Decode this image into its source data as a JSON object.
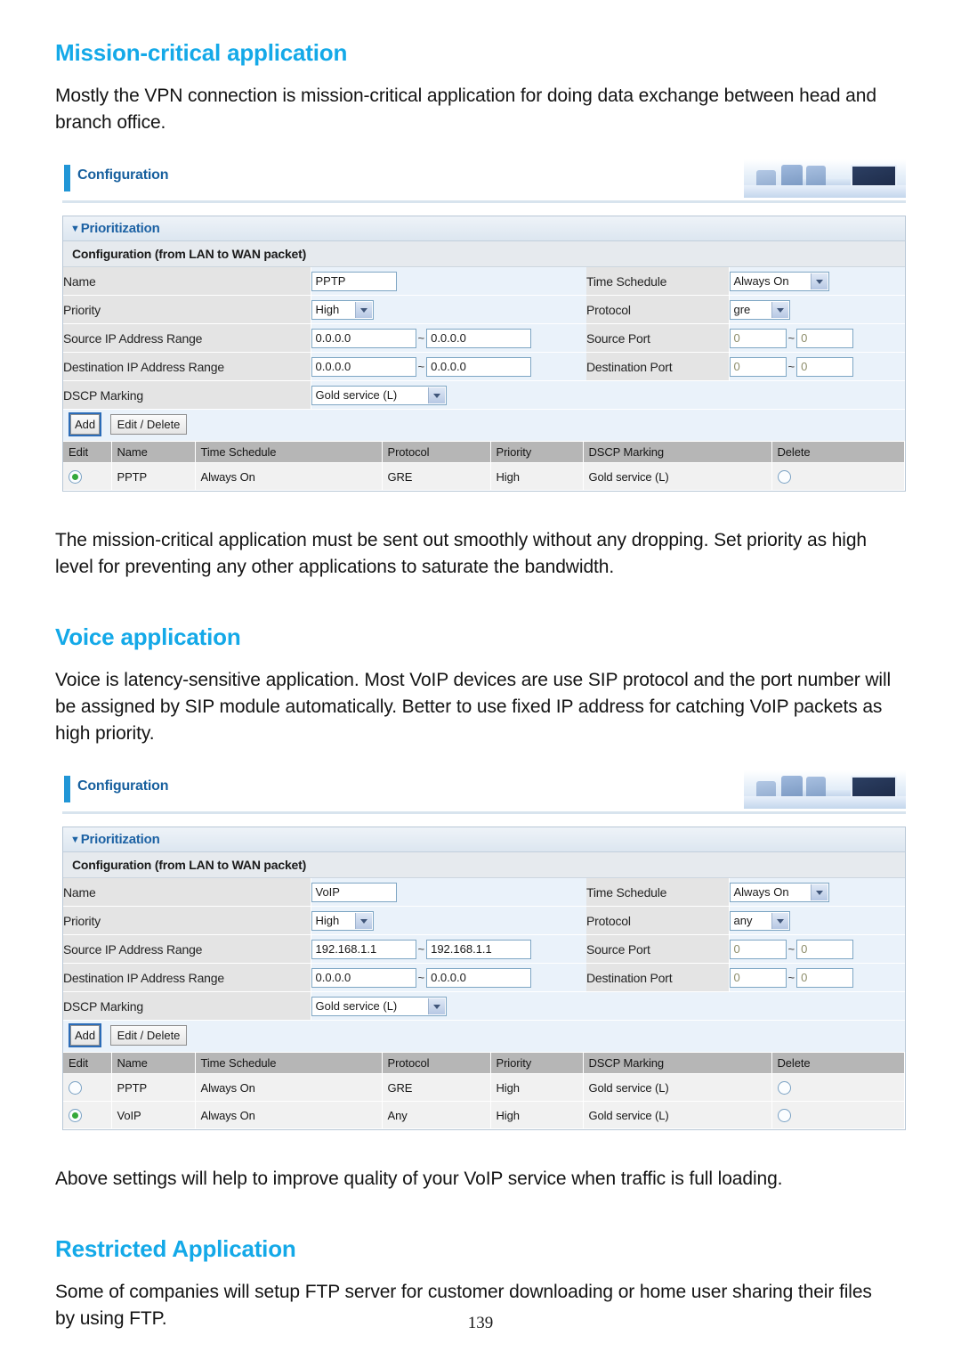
{
  "document": {
    "page_number": "139",
    "heading_color": "#14a9e8",
    "sections": [
      {
        "heading": "Mission-critical application",
        "intro": "Mostly the VPN connection is mission-critical application for doing data exchange between head and branch office.",
        "outro": "The mission-critical application must be sent out smoothly without any dropping. Set priority as high level for preventing any other applications to saturate the bandwidth."
      },
      {
        "heading": "Voice application",
        "intro": "Voice is latency-sensitive application. Most VoIP devices are use SIP protocol and the port number will be assigned by SIP module automatically. Better to use fixed IP address for catching VoIP packets as high priority.",
        "outro": "Above settings will help to improve quality of your VoIP service when traffic is full loading."
      },
      {
        "heading": "Restricted Application",
        "intro": "Some of companies will setup FTP server for customer downloading or home user sharing their files by using FTP.",
        "outro": ""
      }
    ]
  },
  "screenshot_common": {
    "config_title": "Configuration",
    "panel_title": "Prioritization",
    "panel_subtitle": "Configuration (from LAN to WAN packet)",
    "labels": {
      "name": "Name",
      "priority": "Priority",
      "source_ip": "Source IP Address Range",
      "destination_ip": "Destination IP Address Range",
      "dscp": "DSCP Marking",
      "time_schedule": "Time Schedule",
      "protocol": "Protocol",
      "source_port": "Source Port",
      "destination_port": "Destination Port"
    },
    "buttons": {
      "add": "Add",
      "edit_delete": "Edit / Delete"
    },
    "table_headers": [
      "Edit",
      "Name",
      "Time Schedule",
      "Protocol",
      "Priority",
      "DSCP Marking",
      "Delete"
    ],
    "tilde": "~"
  },
  "screenshot_one": {
    "form": {
      "name": "PPTP",
      "priority": "High",
      "source_ip_from": "0.0.0.0",
      "source_ip_to": "0.0.0.0",
      "destination_ip_from": "0.0.0.0",
      "destination_ip_to": "0.0.0.0",
      "dscp": "Gold service (L)",
      "time_schedule": "Always On",
      "protocol": "gre",
      "source_port_from": "0",
      "source_port_to": "0",
      "destination_port_from": "0",
      "destination_port_to": "0"
    },
    "rows": [
      {
        "edit_selected": true,
        "name": "PPTP",
        "time_schedule": "Always On",
        "protocol": "GRE",
        "priority": "High",
        "dscp": "Gold service (L)",
        "delete_selected": false
      }
    ]
  },
  "screenshot_two": {
    "form": {
      "name": "VoIP",
      "priority": "High",
      "source_ip_from": "192.168.1.1",
      "source_ip_to": "192.168.1.1",
      "destination_ip_from": "0.0.0.0",
      "destination_ip_to": "0.0.0.0",
      "dscp": "Gold service (L)",
      "time_schedule": "Always On",
      "protocol": "any",
      "source_port_from": "0",
      "source_port_to": "0",
      "destination_port_from": "0",
      "destination_port_to": "0"
    },
    "rows": [
      {
        "edit_selected": false,
        "name": "PPTP",
        "time_schedule": "Always On",
        "protocol": "GRE",
        "priority": "High",
        "dscp": "Gold service (L)",
        "delete_selected": false
      },
      {
        "edit_selected": true,
        "name": "VoIP",
        "time_schedule": "Always On",
        "protocol": "Any",
        "priority": "High",
        "dscp": "Gold service (L)",
        "delete_selected": false
      }
    ]
  }
}
